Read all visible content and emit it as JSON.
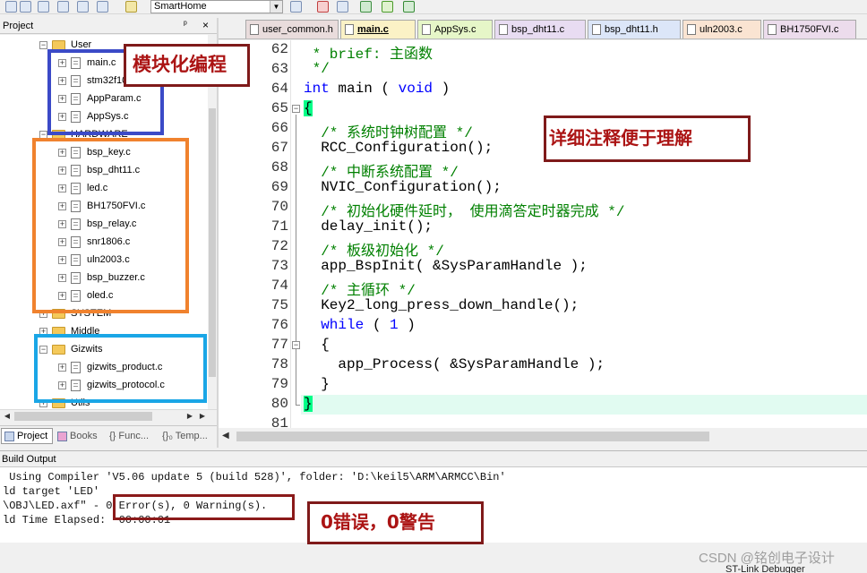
{
  "toolbar": {
    "target_select": "SmartHome",
    "icons": [
      "build-icon",
      "rebuild-icon",
      "batch-build-icon",
      "download-icon",
      "stop-build-icon",
      "target-options-icon",
      "dropdown-icon",
      "manage-components-icon",
      "select-pack-icon",
      "pack-installer-icon",
      "diamond-icon",
      "debug-icon"
    ]
  },
  "project_panel": {
    "title": "Project",
    "pin": "ᵖ",
    "close": "×",
    "tree": {
      "user_group": "User",
      "user_files": [
        "main.c",
        "stm32f10x_it.c",
        "AppParam.c",
        "AppSys.c"
      ],
      "hardware_group": "HARDWARE",
      "hardware_files": [
        "bsp_key.c",
        "bsp_dht11.c",
        "led.c",
        "BH1750FVI.c",
        "bsp_relay.c",
        "snr1806.c",
        "uln2003.c",
        "bsp_buzzer.c",
        "oled.c"
      ],
      "system_group": "SYSTEM",
      "middle_group": "Middle",
      "gizwits_group": "Gizwits",
      "gizwits_files": [
        "gizwits_product.c",
        "gizwits_protocol.c"
      ],
      "utils_group": "Utils"
    },
    "tabs": [
      "Project",
      "Books",
      "{} Func...",
      "{}₀ Temp..."
    ]
  },
  "editor": {
    "tabs": [
      {
        "label": "user_common.h",
        "color": "#e9dcdc"
      },
      {
        "label": "main.c",
        "color": "#fbf2c6"
      },
      {
        "label": "AppSys.c",
        "color": "#e6f6c8"
      },
      {
        "label": "bsp_dht11.c",
        "color": "#e8dcf2"
      },
      {
        "label": "bsp_dht11.h",
        "color": "#dce6f8"
      },
      {
        "label": "uln2003.c",
        "color": "#fae4d2"
      },
      {
        "label": "BH1750FVI.c",
        "color": "#ecdcec"
      }
    ],
    "active_tab": "main.c",
    "line_numbers": [
      "62",
      "63",
      "64",
      "65",
      "66",
      "67",
      "68",
      "69",
      "70",
      "71",
      "72",
      "73",
      "74",
      "75",
      "76",
      "77",
      "78",
      "79",
      "80",
      "81"
    ],
    "lines": {
      "l62": " * brief: 主函数",
      "l63": " */",
      "l64_kw1": "int",
      "l64_mid": " main ( ",
      "l64_kw2": "void",
      "l64_end": " )",
      "l65": "{",
      "l66": "  /* 系统时钟树配置 */",
      "l67": "  RCC_Configuration();",
      "l68": "  /* 中断系统配置 */",
      "l69": "  NVIC_Configuration();",
      "l70": "  /* 初始化硬件延时， 使用滴答定时器完成 */",
      "l71": "  delay_init();",
      "l72": "  /* 板级初始化 */",
      "l73": "  app_BspInit( &SysParamHandle );",
      "l74": "  /* 主循环 */",
      "l75": "  Key2_long_press_down_handle();",
      "l76_kw": "while",
      "l76_mid": " ( ",
      "l76_num": "1",
      "l76_end": " )",
      "l77": "  {",
      "l78": "    app_Process( &SysParamHandle );",
      "l79": "  }",
      "l80": "}"
    }
  },
  "build_output": {
    "title": "Build Output",
    "lines": [
      " Using Compiler 'V5.06 update 5 (build 528)', folder: 'D:\\keil5\\ARM\\ARMCC\\Bin'",
      "ld target 'LED'",
      "\\OBJ\\LED.axf\" - 0 Error(s), 0 Warning(s).",
      "ld Time Elapsed:  00:00:01"
    ]
  },
  "status": {
    "debugger": "ST-Link Debugger"
  },
  "watermark": "CSDN @铭创电子设计",
  "annotations": {
    "modular": "模块化编程",
    "comments": "详细注释便于理解",
    "errors": "0错误，0警告"
  },
  "colors": {
    "keyword": "#0000ff",
    "comment": "#008000",
    "current_line": "#e1fbf1",
    "callout_text": "#ab1414",
    "callout_border": "#7f1a1a",
    "box_blue": "#3b4ac7",
    "box_orange": "#f0822e",
    "box_cyan": "#1aa6e6"
  }
}
